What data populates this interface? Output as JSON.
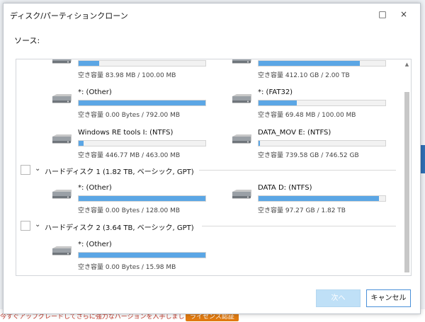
{
  "window": {
    "title": "ディスク/パーティションクローン",
    "minimize_icon": "□",
    "close_icon": "×"
  },
  "source_label": "ソース:",
  "partitions": [
    {
      "name": "",
      "capacity": "空き容量 83.98 MB / 100.00 MB",
      "fill": 0.16
    },
    {
      "name": "",
      "capacity": "空き容量 412.10 GB / 2.00 TB",
      "fill": 0.8
    },
    {
      "name": "*: (Other)",
      "capacity": "空き容量 0.00 Bytes / 792.00 MB",
      "fill": 1.0
    },
    {
      "name": "*: (FAT32)",
      "capacity": "空き容量 69.48 MB / 100.00 MB",
      "fill": 0.3
    },
    {
      "name": "Windows RE tools I: (NTFS)",
      "capacity": "空き容量 446.77 MB / 463.00 MB",
      "fill": 0.04
    },
    {
      "name": "DATA_MOV E: (NTFS)",
      "capacity": "空き容量 739.58 GB / 746.52 GB",
      "fill": 0.01
    },
    {
      "name": "*: (Other)",
      "capacity": "空き容量 0.00 Bytes / 128.00 MB",
      "fill": 1.0
    },
    {
      "name": "DATA D: (NTFS)",
      "capacity": "空き容量 97.27 GB / 1.82 TB",
      "fill": 0.95
    },
    {
      "name": "*: (Other)",
      "capacity": "空き容量 0.00 Bytes / 15.98 MB",
      "fill": 1.0
    }
  ],
  "disks": [
    {
      "label": "ハードディスク 1 (1.82 TB, ベーシック, GPT)"
    },
    {
      "label": "ハードディスク 2 (3.64 TB, ベーシック, GPT)"
    }
  ],
  "buttons": {
    "next": "次へ",
    "cancel": "キャンセル"
  },
  "background": {
    "upgrade_text": "今すぐアップグレードしてさらに強力なバージョンを入手しましょう。",
    "badge": "ライセンス認証"
  },
  "colors": {
    "bar_fill": "#5ba6e5",
    "bar_empty": "#f2f2f2",
    "accent": "#4a90d9"
  }
}
